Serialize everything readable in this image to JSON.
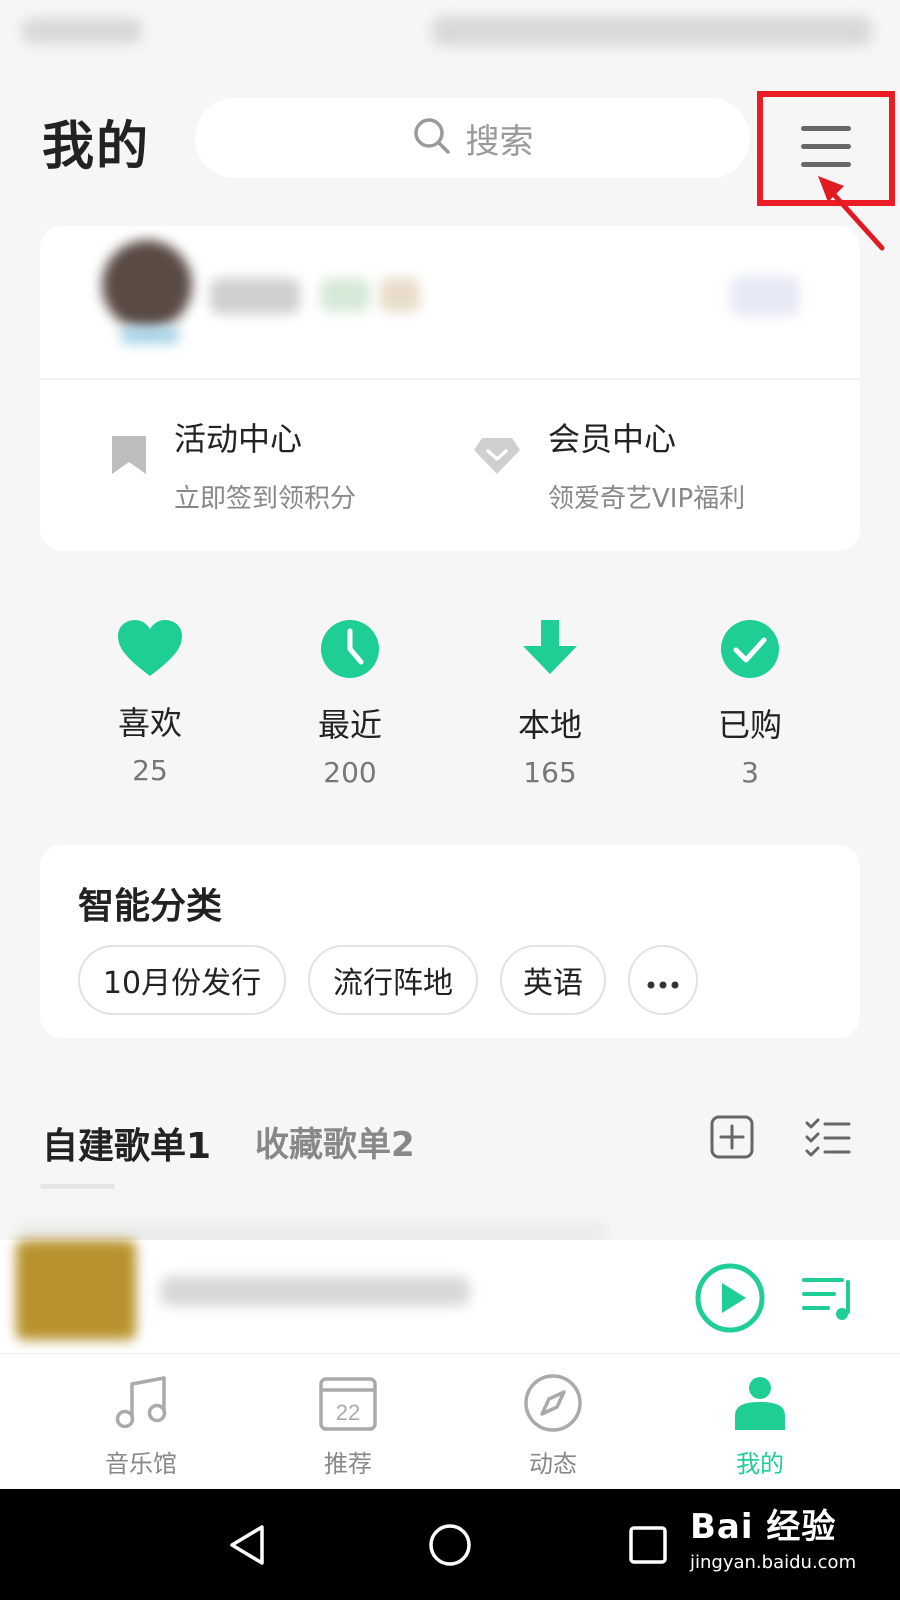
{
  "header": {
    "title": "我的",
    "search_placeholder": "搜索"
  },
  "shortcuts": [
    {
      "title": "活动中心",
      "subtitle": "立即签到领积分"
    },
    {
      "title": "会员中心",
      "subtitle": "领爱奇艺VIP福利"
    }
  ],
  "quick_access": [
    {
      "label": "喜欢",
      "count": "25"
    },
    {
      "label": "最近",
      "count": "200"
    },
    {
      "label": "本地",
      "count": "165"
    },
    {
      "label": "已购",
      "count": "3"
    }
  ],
  "smart_category": {
    "title": "智能分类",
    "chips": [
      "10月份发行",
      "流行阵地",
      "英语"
    ]
  },
  "playlists": {
    "tabs": [
      "自建歌单1",
      "收藏歌单2"
    ]
  },
  "bottom_nav": {
    "items": [
      {
        "label": "音乐馆"
      },
      {
        "label": "推荐",
        "badge": "22"
      },
      {
        "label": "动态"
      },
      {
        "label": "我的"
      }
    ]
  },
  "watermark": {
    "main": "Bai 经验",
    "sub": "jingyan.baidu.com"
  },
  "colors": {
    "accent": "#1fce94",
    "highlight": "#ec1c24"
  }
}
